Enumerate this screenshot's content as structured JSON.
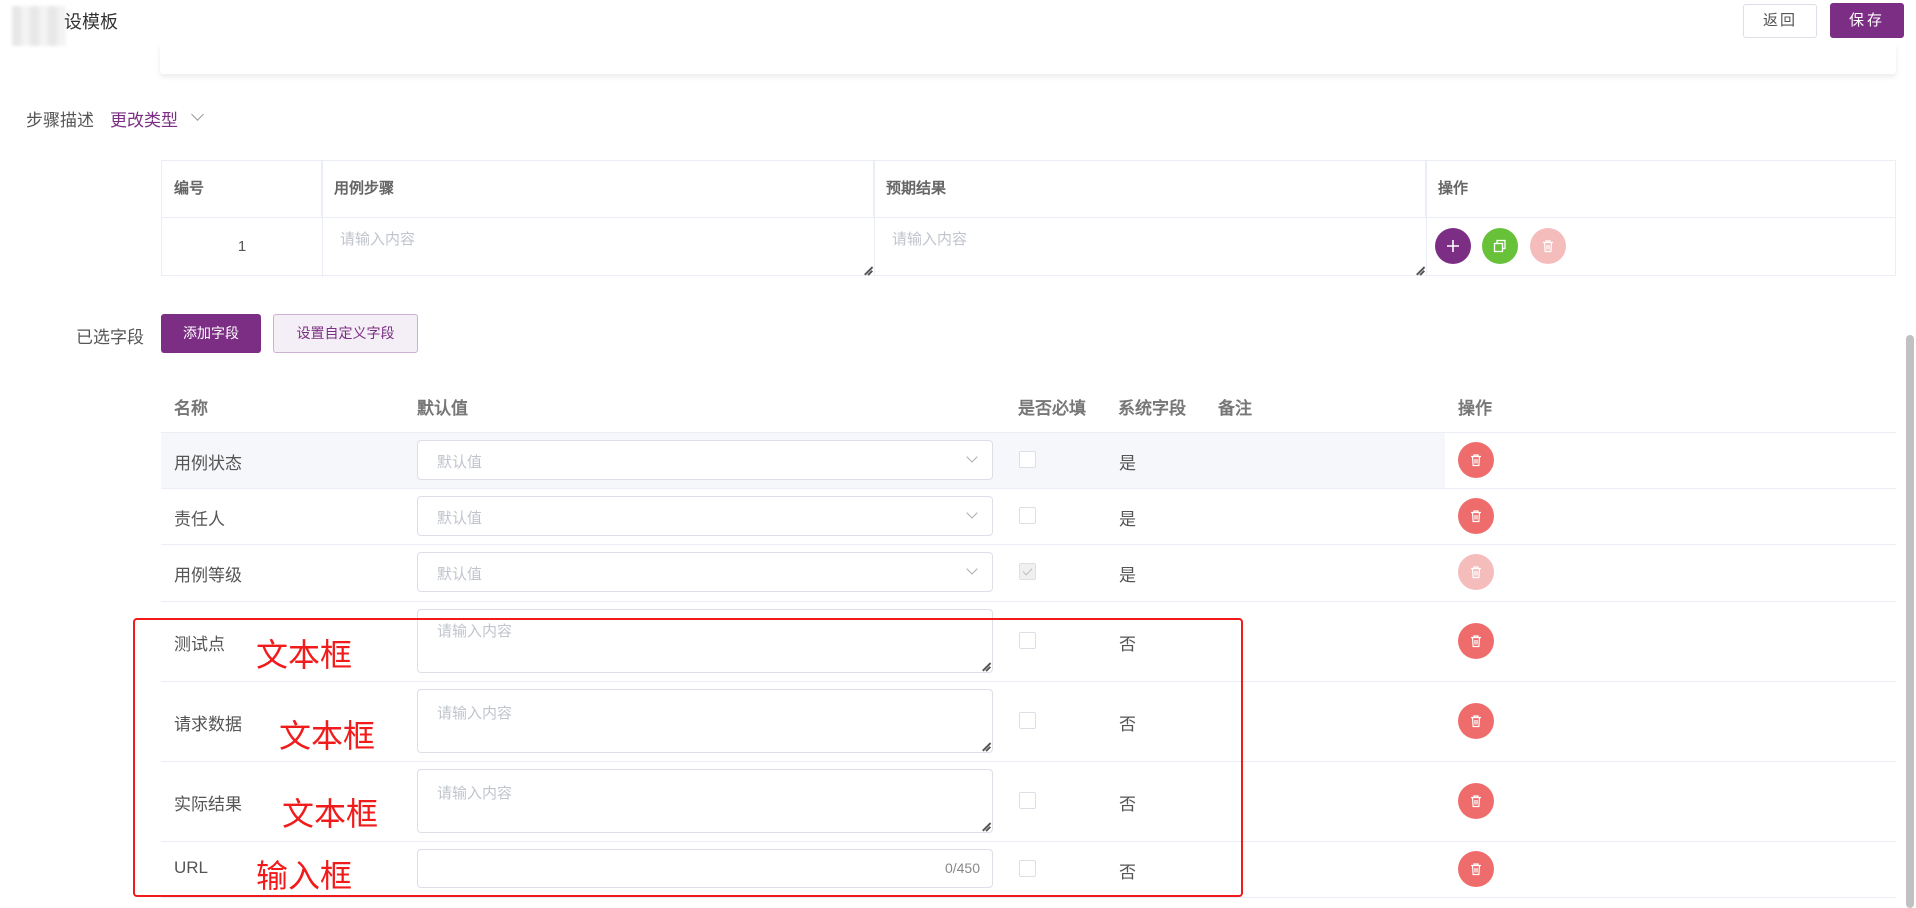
{
  "header": {
    "title": "设模板",
    "back_label": "返回",
    "save_label": "保存"
  },
  "steps": {
    "label": "步骤描述",
    "change_type": "更改类型",
    "headers": [
      "编号",
      "用例步骤",
      "预期结果",
      "操作"
    ],
    "row": {
      "number": "1",
      "step_placeholder": "请输入内容",
      "result_placeholder": "请输入内容"
    },
    "action_icons": [
      "plus-icon",
      "copy-icon",
      "trash-icon"
    ],
    "colors": {
      "add": "#7b2e84",
      "copy": "#67c23a",
      "delete_disabled": "#f5bcbc"
    }
  },
  "fields": {
    "label": "已选字段",
    "add_label": "添加字段",
    "custom_label": "设置自定义字段",
    "headers": {
      "name": "名称",
      "default": "默认值",
      "required": "是否必填",
      "system": "系统字段",
      "remark": "备注",
      "action": "操作"
    },
    "rows": [
      {
        "name": "用例状态",
        "type": "select",
        "placeholder": "默认值",
        "required": false,
        "system": "是",
        "deletable": true
      },
      {
        "name": "责任人",
        "type": "select",
        "placeholder": "默认值",
        "required": false,
        "system": "是",
        "deletable": true
      },
      {
        "name": "用例等级",
        "type": "select",
        "placeholder": "默认值",
        "required": true,
        "system": "是",
        "deletable": false
      },
      {
        "name": "测试点",
        "type": "textarea",
        "placeholder": "请输入内容",
        "required": false,
        "system": "否",
        "deletable": true
      },
      {
        "name": "请求数据",
        "type": "textarea",
        "placeholder": "请输入内容",
        "required": false,
        "system": "否",
        "deletable": true
      },
      {
        "name": "实际结果",
        "type": "textarea",
        "placeholder": "请输入内容",
        "required": false,
        "system": "否",
        "deletable": true
      },
      {
        "name": "URL",
        "type": "input",
        "counter": "0/450",
        "required": false,
        "system": "否",
        "deletable": true
      }
    ]
  },
  "annotations": [
    "文本框",
    "文本框",
    "文本框",
    "输入框"
  ],
  "colors": {
    "primary": "#7b2e84",
    "danger": "#ef6c6c",
    "annotation": "#f21b1b"
  }
}
